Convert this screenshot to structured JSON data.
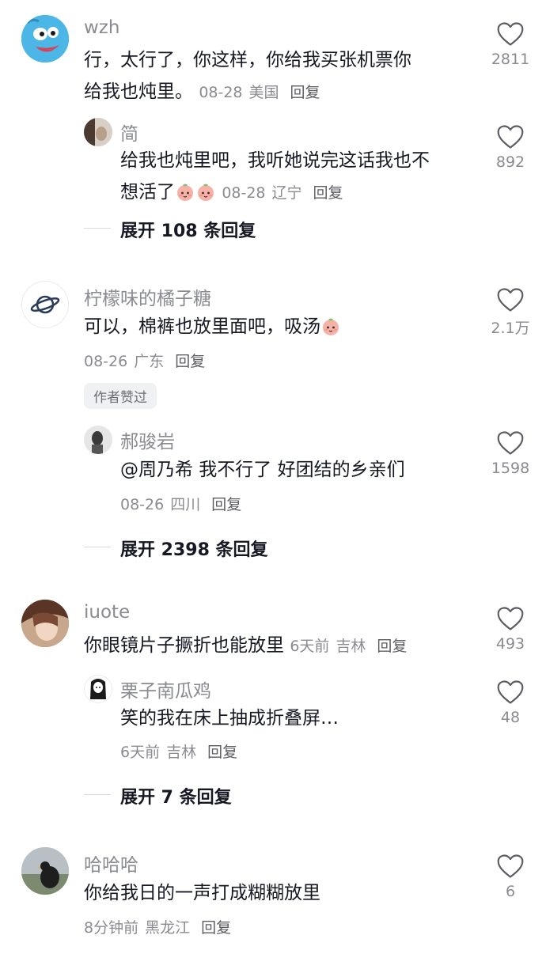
{
  "comments": [
    {
      "name": "wzh",
      "text_line1": "行，太行了，你这样，你给我买张机票你",
      "text_line2": "给我也炖里。",
      "date": "08-28",
      "location": "美国",
      "reply": "回复",
      "likes": "2811",
      "avatar": "blue-cartoon-avatar",
      "replies": [
        {
          "name": "简",
          "text_line1": "给我也炖里吧，我听她说完这话我也不",
          "text_line2": "想活了",
          "emoji": "peach-face-emoji",
          "date": "08-28",
          "location": "辽宁",
          "reply": "回复",
          "likes": "892"
        }
      ],
      "expand": "展开 108 条回复"
    },
    {
      "name": "柠檬味的橘子糖",
      "text": "可以，棉裤也放里面吧，吸汤",
      "emoji": "peach-face-emoji",
      "date": "08-26",
      "location": "广东",
      "reply": "回复",
      "likes": "2.1万",
      "badge": "作者赞过",
      "avatar": "planet-avatar",
      "replies": [
        {
          "name": "郝骏岩",
          "text": "@周乃希  我不行了 好团结的乡亲们",
          "date": "08-26",
          "location": "四川",
          "reply": "回复",
          "likes": "1598"
        }
      ],
      "expand": "展开 2398 条回复"
    },
    {
      "name": "iuote",
      "text": "你眼镜片子撅折也能放里",
      "date": "6天前",
      "location": "吉林",
      "reply": "回复",
      "likes": "493",
      "avatar": "girl-photo-avatar",
      "replies": [
        {
          "name": "栗子南瓜鸡",
          "text": "笑的我在床上抽成折叠屏…",
          "date": "6天前",
          "location": "吉林",
          "reply": "回复",
          "likes": "48"
        }
      ],
      "expand": "展开 7 条回复"
    },
    {
      "name": "哈哈哈",
      "text": "你给我日的一声打成糊糊放里",
      "date": "8分钟前",
      "location": "黑龙江",
      "reply": "回复",
      "likes": "6",
      "avatar": "bird-photo-avatar"
    }
  ],
  "colors": {
    "name_gray": "#8a8b91",
    "text": "#161823",
    "divider": "#d9dadd"
  }
}
